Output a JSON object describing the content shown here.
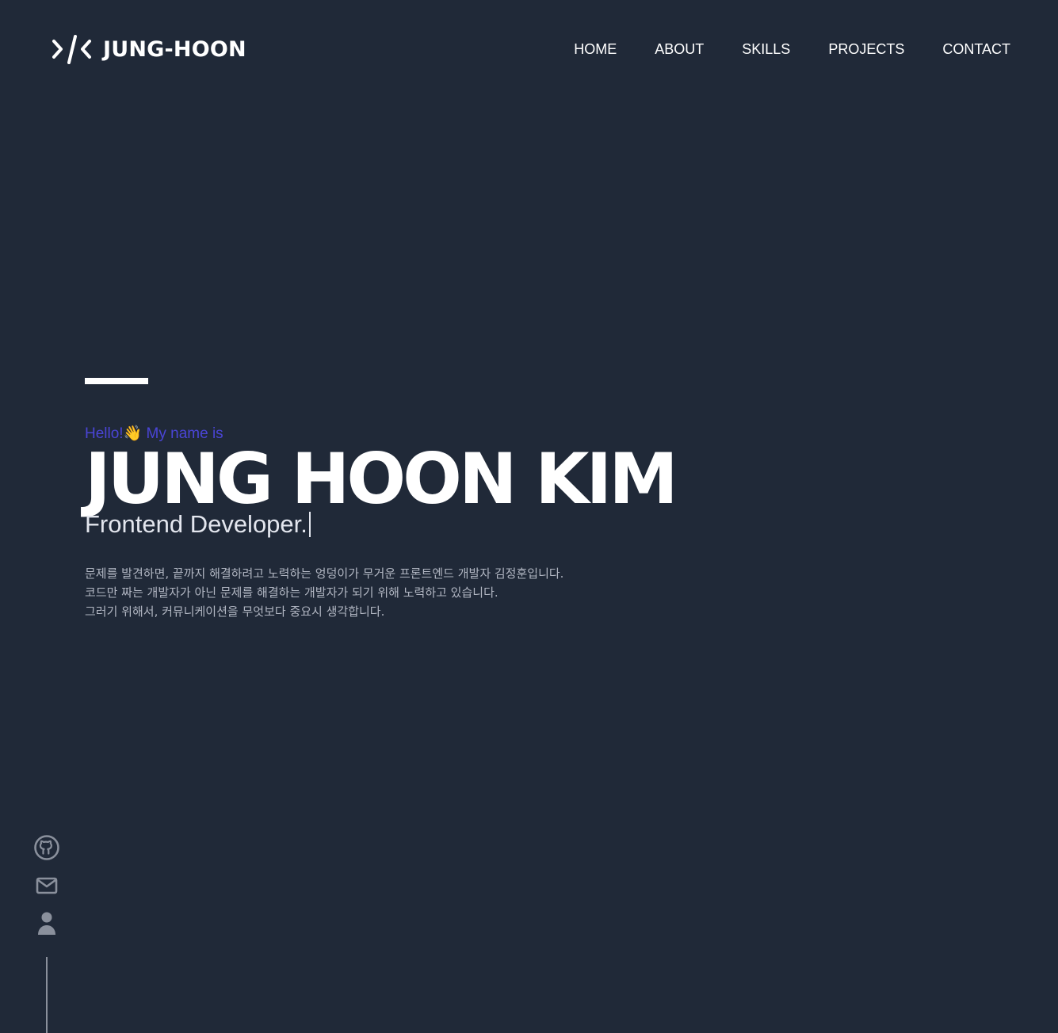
{
  "header": {
    "logo_text": "JUNG-HOON",
    "nav": [
      {
        "label": "HOME"
      },
      {
        "label": "ABOUT"
      },
      {
        "label": "SKILLS"
      },
      {
        "label": "PROJECTS"
      },
      {
        "label": "CONTACT"
      }
    ]
  },
  "hero": {
    "greeting_prefix": "Hello!",
    "greeting_emoji": "👋",
    "greeting_suffix": " My name is",
    "name": "JUNG HOON KIM",
    "role": "Frontend Developer.",
    "intro": [
      "문제를 발견하면, 끝까지 해결하려고 노력하는 엉덩이가 무거운 프론트엔드 개발자 김정훈입니다.",
      "코드만 짜는 개발자가 아닌 문제를 해결하는 개발자가 되기 위해 노력하고 있습니다.",
      "그러기 위해서, 커뮤니케이션을 무엇보다 중요시 생각합니다."
    ]
  },
  "social": [
    {
      "icon": "github-icon"
    },
    {
      "icon": "mail-icon"
    },
    {
      "icon": "user-icon"
    }
  ],
  "colors": {
    "background": "#202938",
    "accent": "#4a45d6",
    "text": "#ffffff",
    "muted": "#b1b6c2",
    "icon": "#8a909c"
  }
}
